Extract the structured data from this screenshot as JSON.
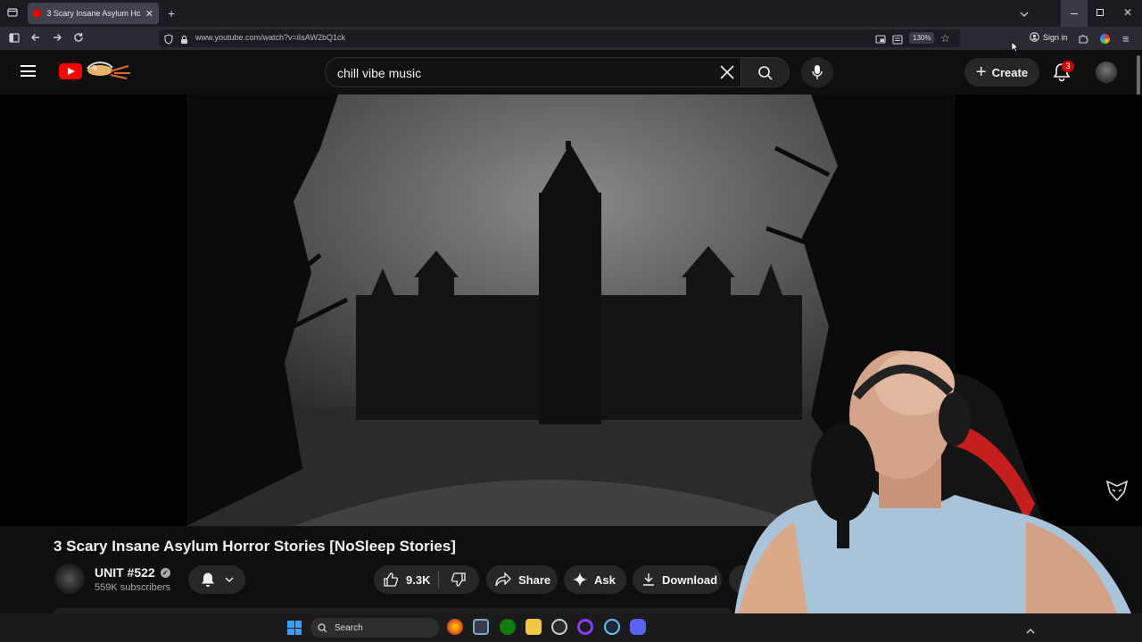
{
  "browser": {
    "tab_title": "3 Scary Insane Asylum Horror St",
    "url": "www.youtube.com/watch?v=iIsAW2bQ1ck",
    "zoom": "130%",
    "sign_in": "Sign in"
  },
  "youtube": {
    "search_query": "chill vibe music",
    "create_label": "Create",
    "notification_count": "3"
  },
  "video": {
    "title": "3 Scary Insane Asylum Horror Stories [NoSleep Stories]",
    "channel_name": "UNIT #522",
    "subscribers": "559K subscribers",
    "likes": "9.3K",
    "share_label": "Share",
    "ask_label": "Ask",
    "download_label": "Download"
  },
  "taskbar": {
    "search_label": "Search"
  },
  "colors": {
    "youtube_red": "#ff0000",
    "background": "#0f0f0f",
    "pill": "#272727",
    "badge": "#cc0000"
  }
}
